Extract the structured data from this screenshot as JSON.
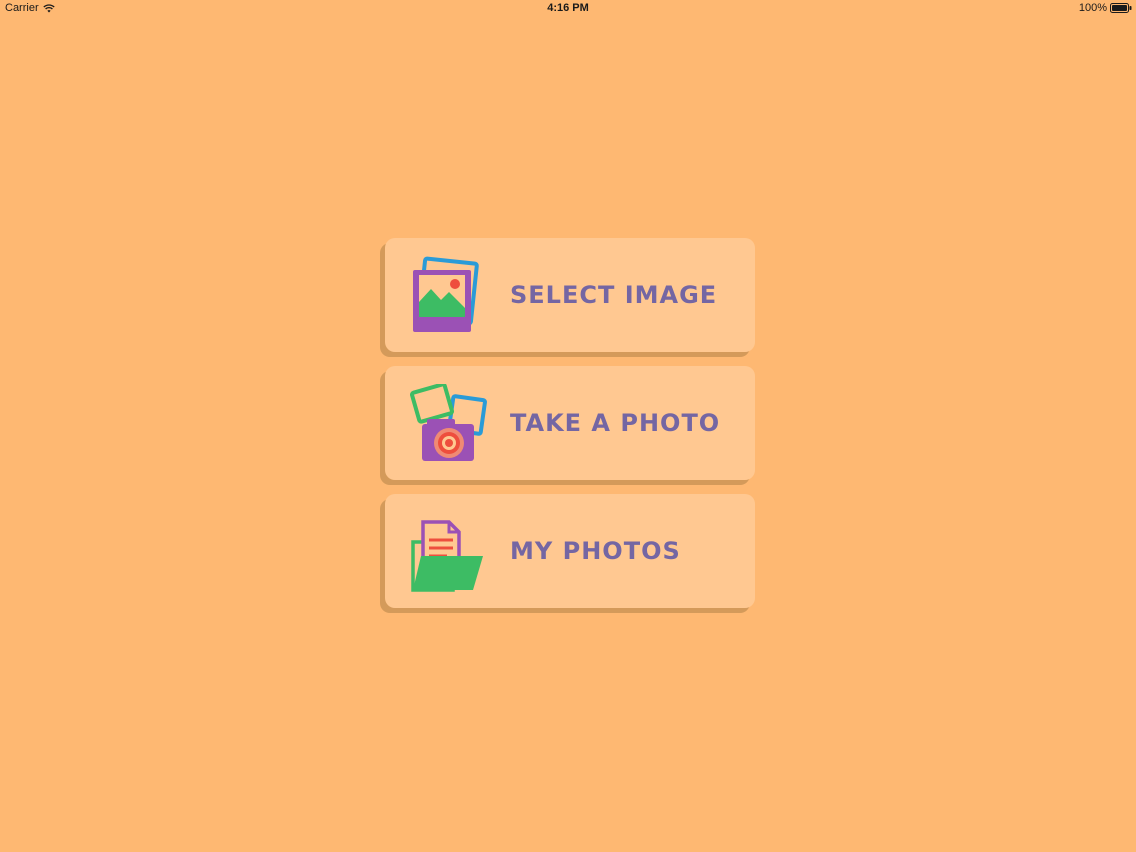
{
  "status_bar": {
    "carrier": "Carrier",
    "time": "4:16 PM",
    "battery": "100%"
  },
  "buttons": [
    {
      "label": "SELECT IMAGE",
      "icon": "photo-gallery-icon"
    },
    {
      "label": "TAKE A PHOTO",
      "icon": "camera-icon"
    },
    {
      "label": "MY PHOTOS",
      "icon": "folder-documents-icon"
    }
  ],
  "colors": {
    "background": "#FEB872",
    "button": "#FFC891",
    "button_shadow": "#D49A5A",
    "label": "#7466A3"
  }
}
